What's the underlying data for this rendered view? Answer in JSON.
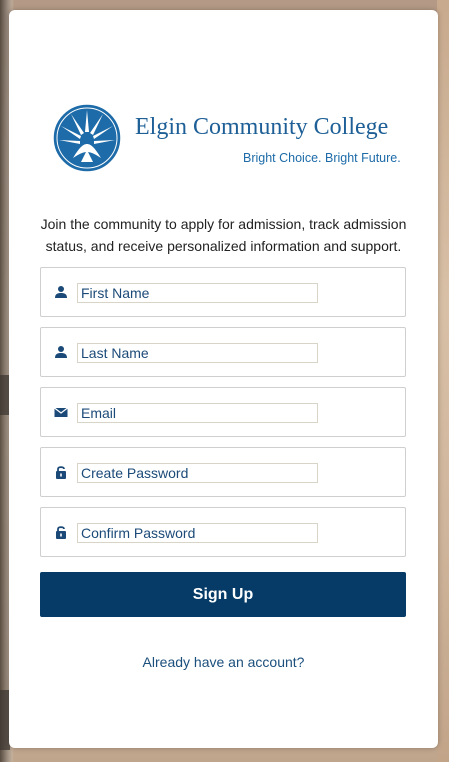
{
  "logo": {
    "name": "Elgin Community College",
    "tagline": "Bright Choice. Bright Future."
  },
  "intro": "Join the community to apply for admission, track admission status, and receive personalized information and support.",
  "fields": [
    {
      "placeholder": "First Name",
      "icon": "person-icon"
    },
    {
      "placeholder": "Last Name",
      "icon": "person-icon"
    },
    {
      "placeholder": "Email",
      "icon": "envelope-icon"
    },
    {
      "placeholder": "Create Password",
      "icon": "lock-icon"
    },
    {
      "placeholder": "Confirm Password",
      "icon": "lock-icon"
    }
  ],
  "signup_label": "Sign Up",
  "already_link": "Already have an account?",
  "colors": {
    "primary": "#053b66",
    "logo_blue": "#1d5f96",
    "link": "#1b4f7c"
  }
}
